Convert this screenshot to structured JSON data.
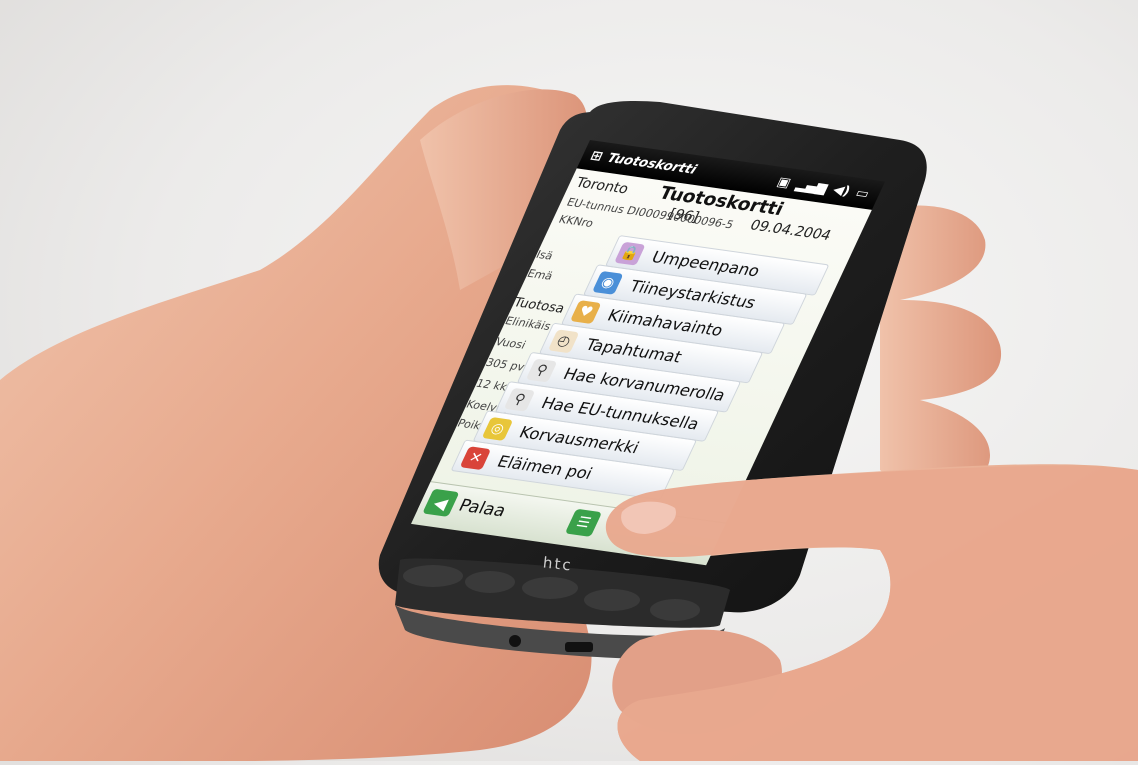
{
  "status": {
    "app_name": "Tuotoskortti",
    "icons": [
      "windows-logo-icon",
      "data-connection-icon",
      "signal-icon",
      "volume-icon",
      "battery-icon"
    ]
  },
  "header": {
    "title": "Tuotoskortti",
    "name": "Toronto",
    "number": "[96]",
    "date": "09.04.2004",
    "eu_id": "EU-tunnus DI000990000096-5",
    "kknro": "KKNro"
  },
  "side_labels": {
    "isa": "Isä",
    "ema": "Emä",
    "tuotosa": "Tuotosa",
    "elinikais": "Elinikäis",
    "vuosi": "Vuosi",
    "pv305": "305 pv",
    "kk12": "12 kk",
    "koelypsy": "Koelypsy",
    "poik": "Poik."
  },
  "menu": [
    {
      "label": "Umpeenpano",
      "icon": "lock-icon"
    },
    {
      "label": "Tiineystarkistus",
      "icon": "eye-icon"
    },
    {
      "label": "Kiimahavainto",
      "icon": "heart-icon"
    },
    {
      "label": "Tapahtumat",
      "icon": "clock-icon"
    },
    {
      "label": "Hae korvanumerolla",
      "icon": "magnifier-icon"
    },
    {
      "label": "Hae EU-tunnuksella",
      "icon": "magnifier-icon"
    },
    {
      "label": "Korvausmerkki",
      "icon": "disc-icon"
    },
    {
      "label": "Eläimen poi",
      "icon": "delete-icon"
    }
  ],
  "bottom": {
    "back_label": "Palaa"
  },
  "device": {
    "brand": "htc"
  },
  "colors": {
    "accent_green": "#3aa14a",
    "delete_red": "#d9443a"
  }
}
